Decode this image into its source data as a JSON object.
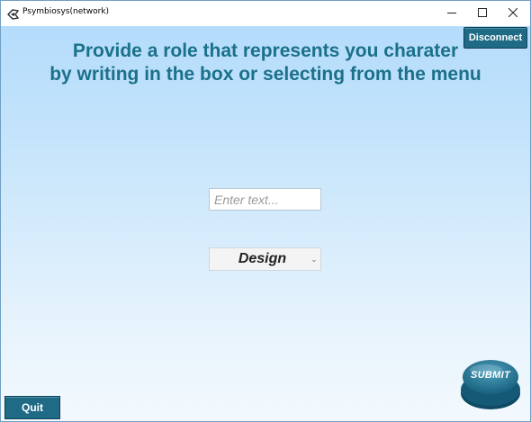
{
  "window": {
    "title": "Psymbiosys(network)",
    "icons": {
      "app": "app-logo-icon",
      "minimize": "minimize-icon",
      "maximize": "maximize-icon",
      "close": "close-icon"
    }
  },
  "header": {
    "line1": "Provide a role that represents you charater",
    "line2": "by writing in the box or selecting from the menu"
  },
  "buttons": {
    "disconnect": "Disconnect",
    "quit": "Quit",
    "submit": "SUBMIT"
  },
  "form": {
    "text_input": {
      "placeholder": "Enter text...",
      "value": ""
    },
    "role_dropdown": {
      "selected": "Design",
      "icon": "chevron-down-icon"
    }
  },
  "colors": {
    "accent": "#1f6b86",
    "heading": "#1b708a",
    "background_top": "#b4dcfb",
    "background_bottom": "#f3f9fe"
  }
}
